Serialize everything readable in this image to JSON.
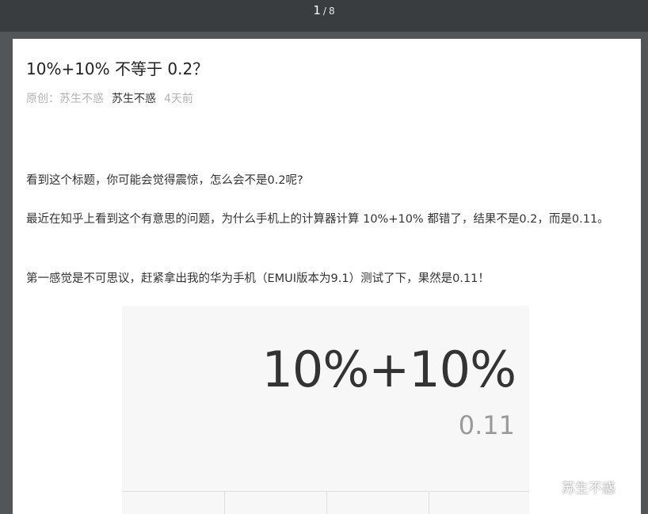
{
  "viewer": {
    "current_page": "1",
    "separator": "/",
    "total_pages": "8"
  },
  "article": {
    "title": "10%+10% 不等于 0.2？",
    "meta": {
      "original_label": "原创：苏生不惑",
      "author": "苏生不惑",
      "time": "4天前"
    },
    "paragraphs": [
      "看到这个标题，你可能会觉得震惊，怎么会不是0.2呢?",
      "最近在知乎上看到这个有意思的问题，为什么手机上的计算器计算 10%+10% 都错了，结果不是0.2，而是0.11。",
      "第一感觉是不可思议，赶紧拿出我的华为手机（EMUI版本为9.1）测试了下，果然是0.11！"
    ],
    "screenshot": {
      "expression": "10%+10%",
      "result": "0.11"
    }
  },
  "watermark": {
    "icon": "wechat-icon",
    "text": "苏生不惑"
  }
}
